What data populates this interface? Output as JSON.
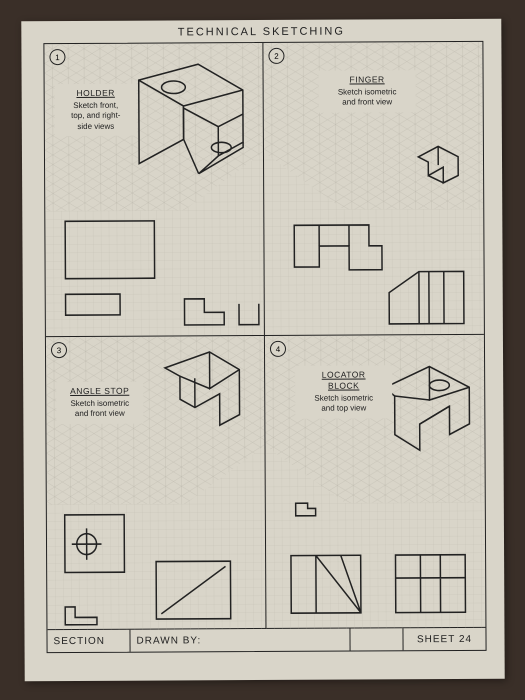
{
  "header": "TECHNICAL SKETCHING",
  "panels": [
    {
      "num": "1",
      "title": "HOLDER",
      "instr": "Sketch front,\ntop, and right-\nside views"
    },
    {
      "num": "2",
      "title": "FINGER",
      "instr": "Sketch isometric\nand front view"
    },
    {
      "num": "3",
      "title": "ANGLE STOP",
      "instr": "Sketch isometric\nand front view"
    },
    {
      "num": "4",
      "title": "LOCATOR\nBLOCK",
      "instr": "Sketch isometric\nand top view"
    }
  ],
  "footer": {
    "section": "SECTION",
    "drawn": "DRAWN BY:",
    "sheet": "SHEET 24"
  }
}
